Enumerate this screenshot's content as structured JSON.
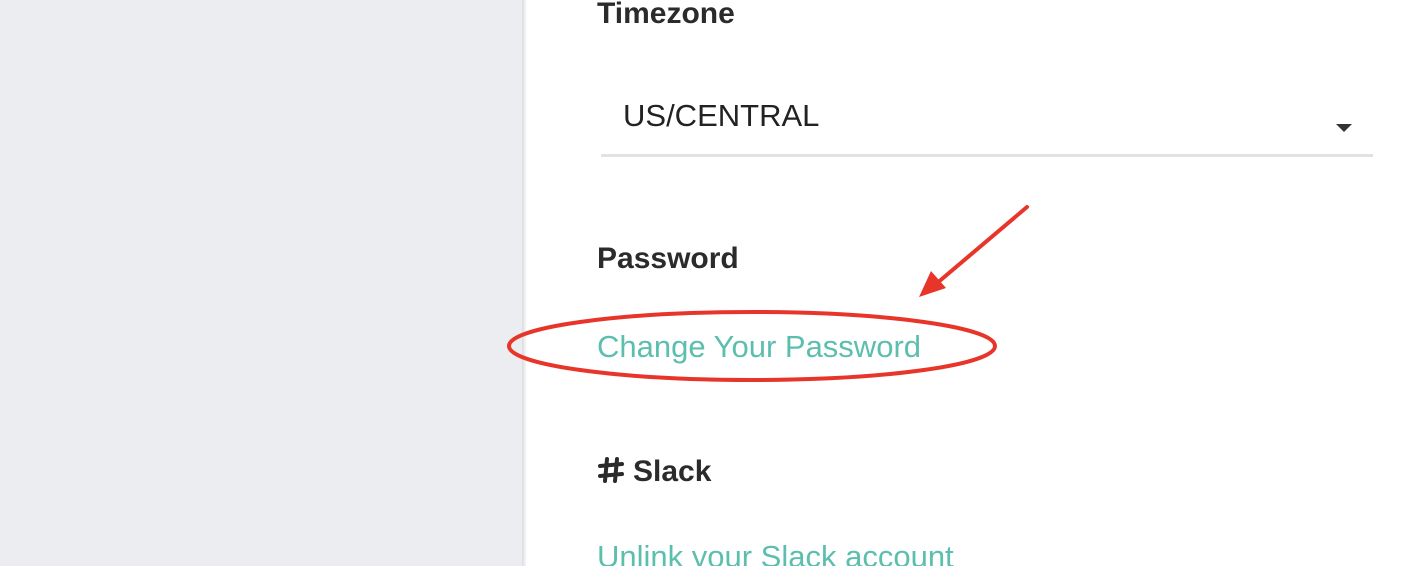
{
  "timezone": {
    "heading": "Timezone",
    "selected_value": "US/CENTRAL"
  },
  "password": {
    "heading": "Password",
    "change_link": "Change Your Password"
  },
  "slack": {
    "heading": "Slack",
    "icon": "hash-icon",
    "unlink_link": "Unlink your Slack account"
  },
  "annotation": {
    "color": "#e8352a"
  },
  "colors": {
    "link": "#5cbfae",
    "heading": "#2b2b2b",
    "sidebar_background": "#ecedf0"
  }
}
